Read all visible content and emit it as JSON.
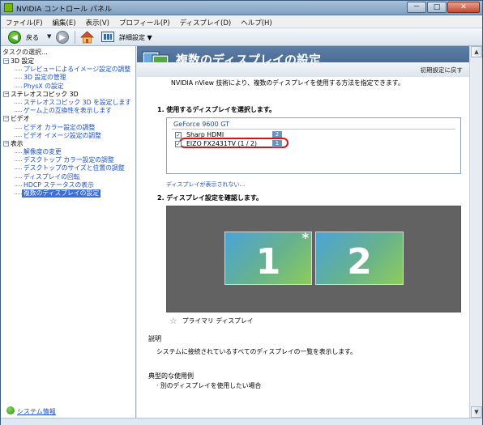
{
  "window": {
    "title": "NVIDIA コントロール パネル"
  },
  "controls": {
    "minimize": "－",
    "maximize": "□",
    "close": "✕"
  },
  "menu": [
    "ファイル(F)",
    "編集(E)",
    "表示(V)",
    "プロフィール(P)",
    "ディスプレイ(D)",
    "ヘルプ(H)"
  ],
  "toolbar": {
    "back_label": "戻る",
    "advanced_label": "詳細設定"
  },
  "sidebar": {
    "header": "タスクの選択...",
    "categories": [
      {
        "label": "3D 設定",
        "items": [
          "プレビューによるイメージ設定の調整",
          "3D 設定の管理",
          "PhysX の設定"
        ]
      },
      {
        "label": "ステレオスコピック 3D",
        "items": [
          "ステレオスコピック 3D を設定します",
          "ゲーム上の互換性を表示します"
        ]
      },
      {
        "label": "ビデオ",
        "items": [
          "ビデオ カラー設定の調整",
          "ビデオ イメージ設定の調整"
        ]
      },
      {
        "label": "表示",
        "items": [
          "解像度の変更",
          "デスクトップ カラー設定の調整",
          "デスクトップのサイズと位置の調整",
          "ディスプレイの回転",
          "HDCP ステータスの表示",
          "複数のディスプレイの設定"
        ]
      }
    ],
    "selected": "複数のディスプレイの設定",
    "system_info": "システム情報"
  },
  "main": {
    "title": "複数のディスプレイの設定",
    "restore_defaults": "初期設定に戻す",
    "description": "NVIDIA nView 技術により、複数のディスプレイを使用する方法を指定できます。",
    "section1": "1. 使用するディスプレイを選択します。",
    "gpu": "GeForce 9600 GT",
    "displays": [
      {
        "name": "Sharp HDMI",
        "badge": "2",
        "checked": true
      },
      {
        "name": "EIZO FX2431TV (1 / 2)",
        "badge": "1",
        "checked": true
      }
    ],
    "no_display_link": "ディスプレイが表示されない...",
    "section2": "2. ディスプレイ設定を確認します。",
    "monitor1": "1",
    "monitor1_star": "*",
    "monitor2": "2",
    "primary_label": "プライマリ ディスプレイ",
    "explain_title": "説明",
    "explain_text": "システムに接続されているすべてのディスプレイの一覧を表示します。",
    "usage_title": "典型的な使用例",
    "usage_text": "· 別のディスプレイを使用したい場合"
  },
  "colors": {
    "highlight": "#d2141c",
    "link": "#1b4fc9",
    "banner": "#4a6d96"
  }
}
